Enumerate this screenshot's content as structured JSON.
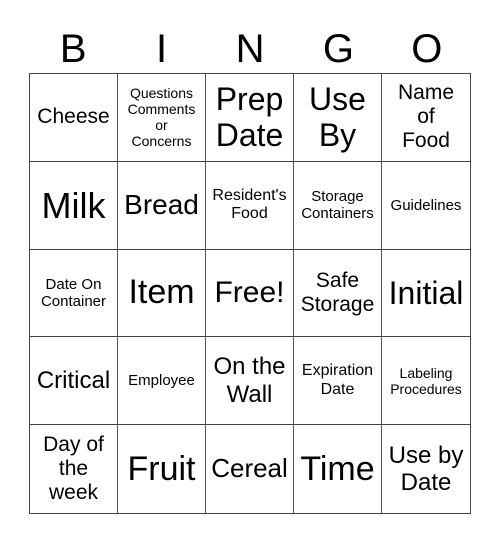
{
  "header": [
    "B",
    "I",
    "N",
    "G",
    "O"
  ],
  "cells": [
    {
      "text": "Cheese",
      "size": 21
    },
    {
      "text": "Questions Comments or Concerns",
      "size": 14,
      "lines": [
        "Questions",
        "Comments",
        "or",
        "Concerns"
      ]
    },
    {
      "text": "Prep Date",
      "size": 32,
      "lines": [
        "Prep",
        "Date"
      ]
    },
    {
      "text": "Use By",
      "size": 32,
      "lines": [
        "Use",
        "By"
      ]
    },
    {
      "text": "Name of Food",
      "size": 21,
      "lines": [
        "Name",
        "of",
        "Food"
      ]
    },
    {
      "text": "Milk",
      "size": 36
    },
    {
      "text": "Bread",
      "size": 28
    },
    {
      "text": "Resident's Food",
      "size": 16,
      "lines": [
        "Resident's",
        "Food"
      ]
    },
    {
      "text": "Storage Containers",
      "size": 15,
      "lines": [
        "Storage",
        "Containers"
      ]
    },
    {
      "text": "Guidelines",
      "size": 15
    },
    {
      "text": "Date On Container",
      "size": 15,
      "lines": [
        "Date On",
        "Container"
      ]
    },
    {
      "text": "Item",
      "size": 34
    },
    {
      "text": "Free!",
      "size": 30
    },
    {
      "text": "Safe Storage",
      "size": 21,
      "lines": [
        "Safe",
        "Storage"
      ]
    },
    {
      "text": "Initial",
      "size": 32
    },
    {
      "text": "Critical",
      "size": 24
    },
    {
      "text": "Employee",
      "size": 15
    },
    {
      "text": "On the Wall",
      "size": 24,
      "lines": [
        "On the",
        "Wall"
      ]
    },
    {
      "text": "Expiration Date",
      "size": 16,
      "lines": [
        "Expiration",
        "Date"
      ]
    },
    {
      "text": "Labeling Procedures",
      "size": 14,
      "lines": [
        "Labeling",
        "Procedures"
      ]
    },
    {
      "text": "Day of the week",
      "size": 21,
      "lines": [
        "Day of",
        "the",
        "week"
      ]
    },
    {
      "text": "Fruit",
      "size": 34
    },
    {
      "text": "Cereal",
      "size": 26
    },
    {
      "text": "Time",
      "size": 34
    },
    {
      "text": "Use by Date",
      "size": 24,
      "lines": [
        "Use by",
        "Date"
      ]
    }
  ]
}
